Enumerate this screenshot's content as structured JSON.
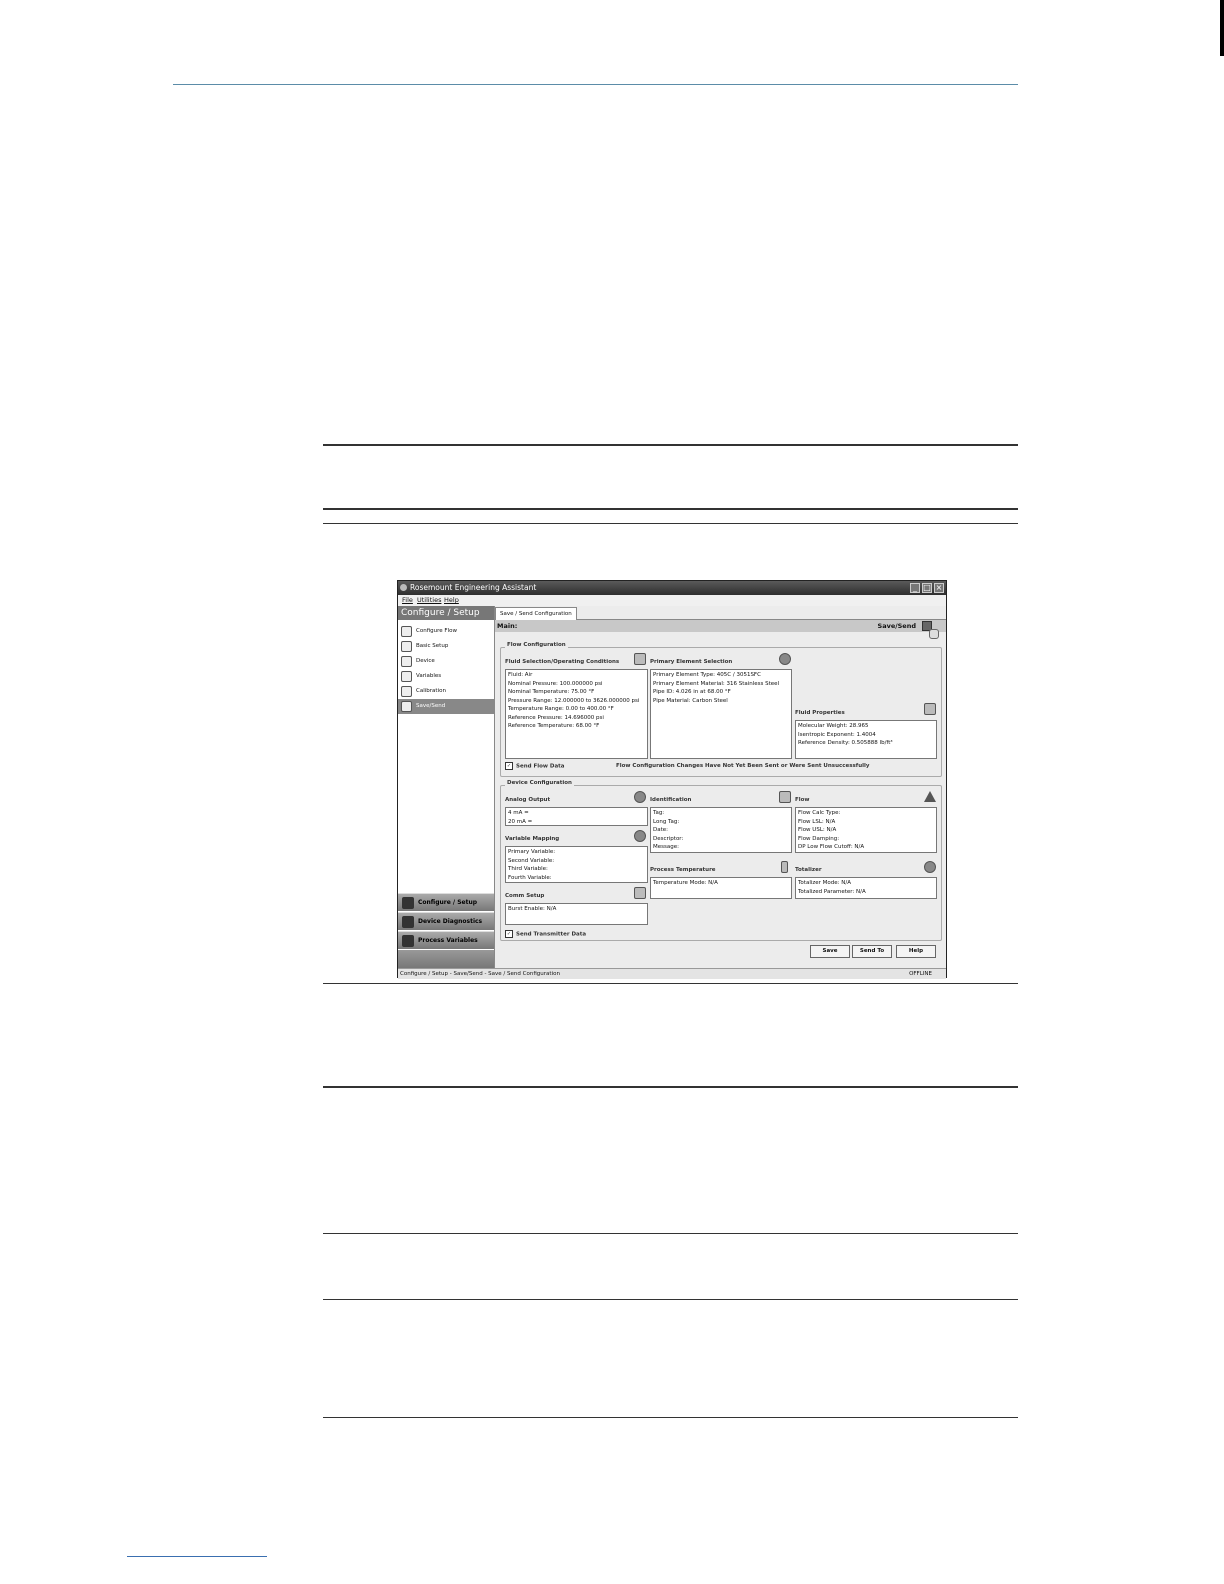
{
  "window": {
    "title": "Rosemount Engineering Assistant",
    "menu": [
      "File",
      "Utilities",
      "Help"
    ]
  },
  "sidebar": {
    "header": "Configure / Setup",
    "items": [
      {
        "label": "Configure Flow"
      },
      {
        "label": "Basic Setup"
      },
      {
        "label": "Device"
      },
      {
        "label": "Variables"
      },
      {
        "label": "Calibration"
      },
      {
        "label": "Save/Send",
        "selected": true
      }
    ],
    "nav_buttons": [
      {
        "label": "Configure / Setup"
      },
      {
        "label": "Device Diagnostics"
      },
      {
        "label": "Process Variables"
      }
    ]
  },
  "tab": {
    "label": "Save / Send Configuration"
  },
  "header": {
    "left": "Main:",
    "right": "Save/Send"
  },
  "flow_config": {
    "title": "Flow Configuration",
    "fluid": {
      "title": "Fluid Selection/Operating Conditions",
      "lines": [
        "Fluid: Air",
        "Nominal Pressure: 100.000000 psi",
        "Nominal Temperature: 75.00 °F",
        "Pressure Range: 12.000000 to 3626.000000 psi",
        "Temperature Range: 0.00 to 400.00 °F",
        "Reference Pressure: 14.696000 psi",
        "Reference Temperature: 68.00 °F"
      ]
    },
    "primary": {
      "title": "Primary Element Selection",
      "lines": [
        "Primary Element Type: 405C / 3051SFC",
        "Primary Element Material: 316 Stainless Steel",
        "Pipe ID: 4.026 in at 68.00 °F",
        "Pipe Material: Carbon Steel"
      ]
    },
    "properties": {
      "title": "Fluid Properties",
      "lines": [
        "Molecular Weight: 28.965",
        "Isentropic Exponent: 1.4004",
        "Reference Density: 0.505888 lb/ft³"
      ]
    },
    "send_label": "Send Flow Data",
    "warning": "Flow Configuration Changes Have Not Yet Been Sent or Were Sent Unsuccessfully"
  },
  "device_config": {
    "title": "Device Configuration",
    "analog": {
      "title": "Analog Output",
      "lines": [
        "4 mA =",
        "20 mA ="
      ]
    },
    "mapping": {
      "title": "Variable Mapping",
      "lines": [
        "Primary Variable:",
        "Second Variable:",
        "Third Variable:",
        "Fourth Variable:"
      ]
    },
    "comm": {
      "title": "Comm Setup",
      "lines": [
        "Burst Enable: N/A"
      ]
    },
    "ident": {
      "title": "Identification",
      "lines": [
        "Tag:",
        "Long Tag:",
        "Date:",
        "Descriptor:",
        "Message:"
      ]
    },
    "flow": {
      "title": "Flow",
      "lines": [
        "Flow Calc Type:",
        "Flow LSL:  N/A",
        "Flow USL:  N/A",
        "Flow Damping:",
        "DP Low Flow Cutoff:  N/A"
      ]
    },
    "proc_temp": {
      "title": "Process Temperature",
      "lines": [
        "Temperature Mode: N/A"
      ]
    },
    "totalizer": {
      "title": "Totalizer",
      "lines": [
        "Totalizer Mode: N/A",
        "Totalized Parameter: N/A"
      ]
    },
    "send_label": "Send Transmitter Data"
  },
  "buttons": {
    "save": "Save",
    "send_to": "Send To",
    "help": "Help"
  },
  "status": {
    "left": "Configure / Setup - Save/Send - Save / Send Configuration",
    "right": "OFFLINE"
  }
}
